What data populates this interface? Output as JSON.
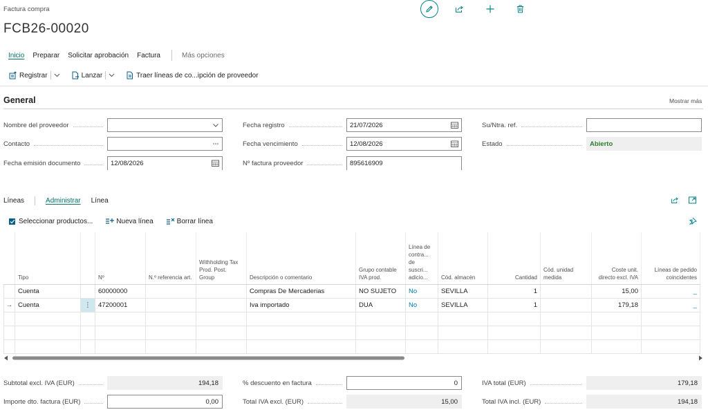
{
  "header": {
    "breadcrumb": "Factura compra",
    "title": "FCB26-00020",
    "actions": [
      "edit-icon",
      "share-icon",
      "plus-icon",
      "trash-icon"
    ],
    "accent": "#008489"
  },
  "menu": {
    "items": [
      "Inicio",
      "Preparar",
      "Solicitar aprobación",
      "Factura"
    ],
    "more": "Más opciones"
  },
  "actionbar": {
    "registrar": "Registrar",
    "lanzar": "Lanzar",
    "traer": "Traer líneas de co...ipción de proveedor"
  },
  "general": {
    "title": "General",
    "show_more": "Mostrar más",
    "fields": {
      "nombre_proveedor": {
        "label": "Nombre del proveedor",
        "value": ""
      },
      "contacto": {
        "label": "Contacto",
        "value": ""
      },
      "fecha_emision": {
        "label": "Fecha emisión documento",
        "value": "12/08/2026"
      },
      "fecha_registro": {
        "label": "Fecha registro",
        "value": "21/07/2026"
      },
      "fecha_vencimiento": {
        "label": "Fecha vencimiento",
        "value": "12/08/2026"
      },
      "n_factura_proveedor": {
        "label": "Nº factura proveedor",
        "value": "895616909"
      },
      "su_ntra_ref": {
        "label": "Su/Ntra. ref.",
        "value": ""
      },
      "estado": {
        "label": "Estado",
        "value": "Abierto"
      }
    }
  },
  "lines": {
    "title": "Líneas",
    "tabs": [
      "Administrar",
      "Línea"
    ],
    "actions": {
      "select_products": "Seleccionar productos...",
      "new_line": "Nueva línea",
      "delete_line": "Borrar línea"
    },
    "columns": [
      "Tipo",
      "Nº",
      "N.º referencia art.",
      "Withholding Tax Prod. Post. Group",
      "Descripción o comentario",
      "Grupo contable IVA prod.",
      "Línea de contra... de suscri... adicio...",
      "Cód. almacén",
      "Cantidad",
      "Cód. unidad medida",
      "Coste unit. directo excl. IVA",
      "Líneas de pedido coincidentes"
    ],
    "rows": [
      {
        "tipo": "Cuenta",
        "no": "60000000",
        "ref": "",
        "withholding": "",
        "descripcion": "Compras De Mercaderias",
        "grupo_iva": "NO SUJETO",
        "linea_contrato": "No",
        "almacen": "SEVILLA",
        "cantidad": "1",
        "unidad": "",
        "coste": "15,00",
        "coincidentes": "_"
      },
      {
        "tipo": "Cuenta",
        "no": "47200001",
        "ref": "",
        "withholding": "",
        "descripcion": "Iva importado",
        "grupo_iva": "DUA",
        "linea_contrato": "No",
        "almacen": "SEVILLA",
        "cantidad": "1",
        "unidad": "",
        "coste": "179,18",
        "coincidentes": "_"
      }
    ],
    "current_row_marker": "→",
    "row_menu": "⋮"
  },
  "totals": {
    "subtotal": {
      "label": "Subtotal excl. IVA (EUR)",
      "value": "194,18"
    },
    "importe_dto": {
      "label": "Importe dto. factura (EUR)",
      "value": "0,00"
    },
    "pct_descuento": {
      "label": "% descuento en factura",
      "value": "0"
    },
    "total_iva_excl": {
      "label": "Total IVA excl. (EUR)",
      "value": "15,00"
    },
    "iva_total": {
      "label": "IVA total (EUR)",
      "value": "179,18"
    },
    "total_iva_incl": {
      "label": "Total IVA incl. (EUR)",
      "value": "194,18"
    }
  }
}
